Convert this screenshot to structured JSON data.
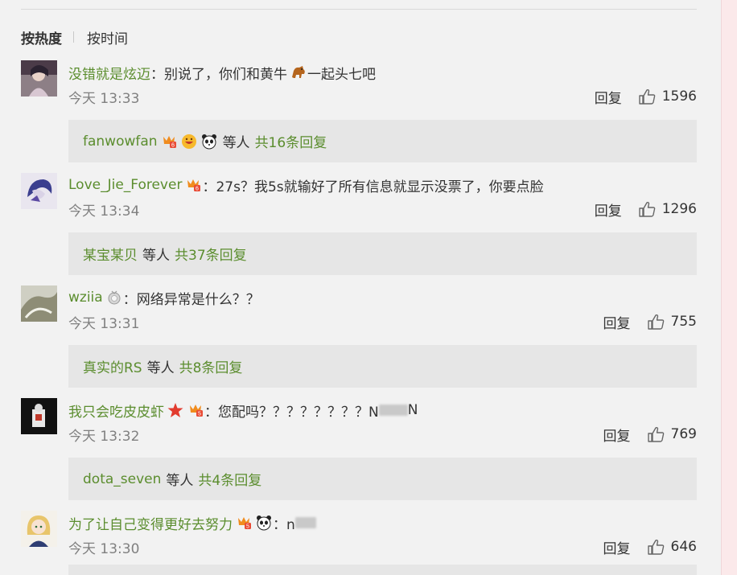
{
  "sort": {
    "hot": "按热度",
    "time": "按时间"
  },
  "reply_label": "回复",
  "comments": [
    {
      "user": "没错就是炫迈",
      "text": "：别说了，你们和黄牛",
      "text2": "一起头七吧",
      "time": "今天 13:33",
      "likes": "1596",
      "sub": {
        "users": "fanwowfan",
        "dengren": "等人",
        "count": "共16条回复"
      }
    },
    {
      "user": "Love_Jie_Forever",
      "text": "：27s？我5s就输好了所有信息就显示没票了，你要点脸",
      "time": "今天 13:34",
      "likes": "1296",
      "sub": {
        "users": "某宝某贝",
        "dengren": "等人",
        "count": "共37条回复"
      }
    },
    {
      "user": "wziia",
      "text": "：网络异常是什么？？",
      "time": "今天 13:31",
      "likes": "755",
      "sub": {
        "users": "真实的RS",
        "dengren": "等人",
        "count": "共8条回复"
      }
    },
    {
      "user": "我只会吃皮皮虾",
      "text": "：您配吗？？？？？？？？N",
      "text2": "N",
      "time": "今天 13:32",
      "likes": "769",
      "sub": {
        "users": "dota_seven",
        "dengren": "等人",
        "count": "共4条回复"
      }
    },
    {
      "user": "为了让自己变得更好去努力",
      "text": "：n",
      "time": "今天 13:30",
      "likes": "646"
    }
  ],
  "colors": {
    "username": "#5b8d2e",
    "meta": "#808080",
    "subbox_bg": "#e6e6e6"
  },
  "icons": [
    "thumb-up-icon",
    "vip-badge-icon",
    "horse-emoji-icon",
    "grin-emoji-icon",
    "panda-emoji-icon",
    "star-icon",
    "medal-icon"
  ]
}
